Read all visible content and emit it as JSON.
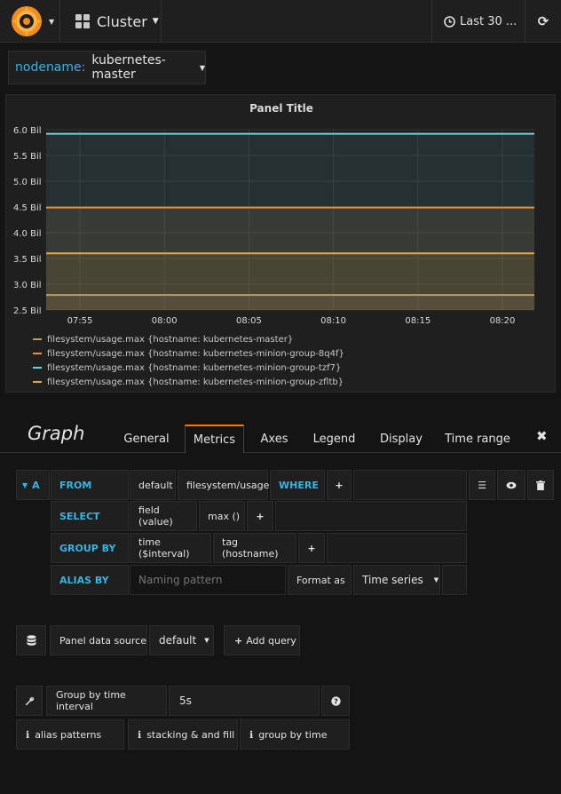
{
  "topbar": {
    "dashboard_title": "Cluster",
    "time_range": "Last 30 ...",
    "refresh_icon": "refresh-icon",
    "logo_icon": "grafana-logo-icon"
  },
  "variable": {
    "label": "nodename:",
    "value": "kubernetes-master"
  },
  "panel": {
    "title": "Panel Title"
  },
  "colors": {
    "orange": "#e5a93c",
    "orange2": "#e89436",
    "blue": "#6ed0e0",
    "bg": "#141414",
    "accent": "#33b5e5"
  },
  "chart_data": {
    "type": "line",
    "x": [
      "07:55",
      "08:00",
      "08:05",
      "08:10",
      "08:15",
      "08:20"
    ],
    "y_ticks": [
      "6.0 Bil",
      "5.5 Bil",
      "5.0 Bil",
      "4.5 Bil",
      "4.0 Bil",
      "3.5 Bil",
      "3.0 Bil",
      "2.5 Bil"
    ],
    "ylim": [
      2.5,
      6.0
    ],
    "fill": true,
    "grid": true,
    "legend_position": "bottom-left",
    "series": [
      {
        "name": "filesystem/usage.max {hostname: kubernetes-master}",
        "color": "#b8a06a",
        "values": [
          2.79,
          2.79,
          2.79,
          2.79,
          2.79,
          2.79
        ]
      },
      {
        "name": "filesystem/usage.max {hostname: kubernetes-minion-group-8q4f}",
        "color": "#e89436",
        "values": [
          4.49,
          4.49,
          4.49,
          4.49,
          4.49,
          4.49
        ]
      },
      {
        "name": "filesystem/usage.max {hostname: kubernetes-minion-group-tzf7}",
        "color": "#6ed0e0",
        "values": [
          5.92,
          5.92,
          5.92,
          5.92,
          5.92,
          5.92
        ]
      },
      {
        "name": "filesystem/usage.max {hostname: kubernetes-minion-group-zfltb}",
        "color": "#e5a93c",
        "values": [
          3.6,
          3.6,
          3.6,
          3.6,
          3.6,
          3.6
        ]
      }
    ]
  },
  "editor": {
    "title": "Graph",
    "tabs": [
      "General",
      "Metrics",
      "Axes",
      "Legend",
      "Display",
      "Time range"
    ],
    "active_tab": "Metrics",
    "close": "✖"
  },
  "query": {
    "ref_id": "A",
    "from_label": "FROM",
    "from_policy": "default",
    "from_measurement": "filesystem/usage",
    "where_label": "WHERE",
    "select_label": "SELECT",
    "select_field": "field (value)",
    "select_func": "max ()",
    "groupby_label": "GROUP BY",
    "groupby_time": "time ($interval)",
    "groupby_tag": "tag (hostname)",
    "alias_label": "ALIAS BY",
    "alias_placeholder": "Naming pattern",
    "format_label": "Format as",
    "format_value": "Time series",
    "plus": "+"
  },
  "datasource": {
    "label": "Panel data source",
    "value": "default",
    "add_query": "Add query"
  },
  "options": {
    "group_interval_label": "Group by time interval",
    "group_interval_value": "5s",
    "alias_patterns": "alias patterns",
    "stacking_fill": "stacking & and fill",
    "group_by_time": "group by time"
  }
}
